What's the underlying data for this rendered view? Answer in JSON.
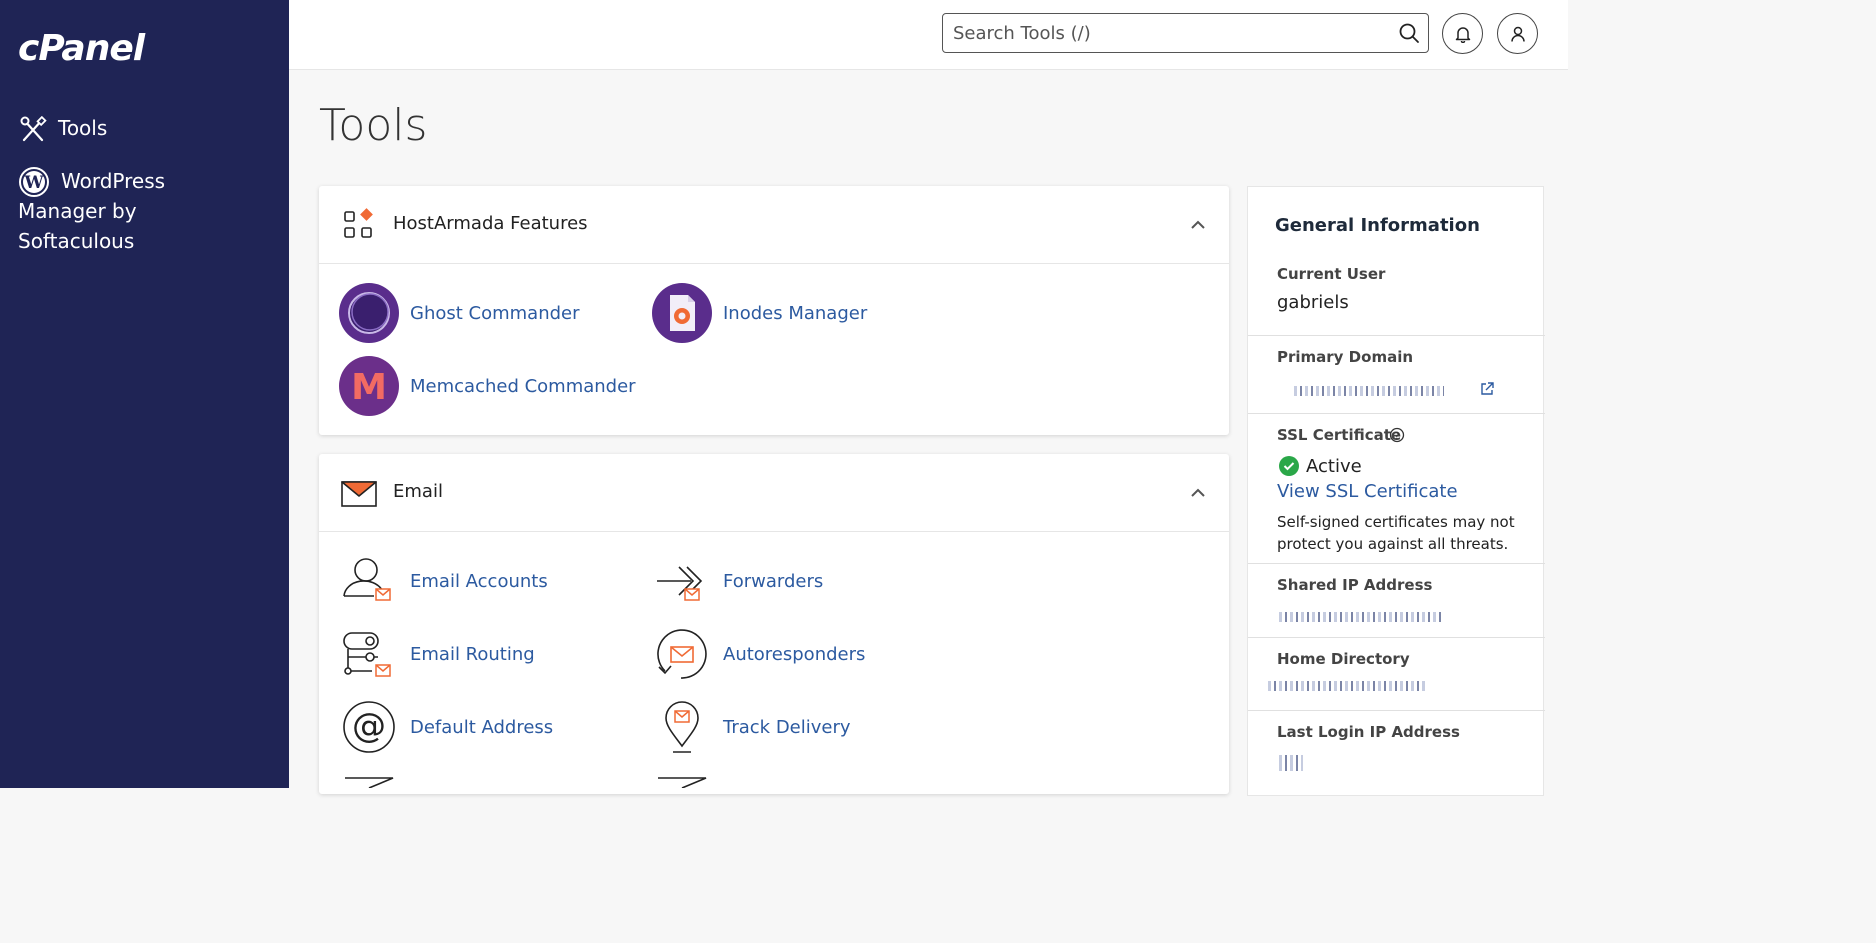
{
  "sidebar": {
    "logo": "cPanel",
    "items": [
      {
        "label": "Tools",
        "icon": "tools-icon"
      },
      {
        "label": "WordPress Manager by Softaculous",
        "icon": "wordpress-icon"
      }
    ],
    "bg_color": "#1f2455"
  },
  "header": {
    "search_placeholder": "Search Tools (/)"
  },
  "page": {
    "title": "Tools"
  },
  "sections": {
    "hostarmada": {
      "title": "HostArmada Features",
      "tools": [
        {
          "label": "Ghost Commander",
          "icon": "ghost-commander-icon"
        },
        {
          "label": "Inodes Manager",
          "icon": "inodes-manager-icon"
        },
        {
          "label": "Memcached Commander",
          "icon": "memcached-commander-icon"
        }
      ]
    },
    "email": {
      "title": "Email",
      "tools": [
        {
          "label": "Email Accounts",
          "icon": "email-accounts-icon"
        },
        {
          "label": "Forwarders",
          "icon": "forwarders-icon"
        },
        {
          "label": "Email Routing",
          "icon": "email-routing-icon"
        },
        {
          "label": "Autoresponders",
          "icon": "autoresponders-icon"
        },
        {
          "label": "Default Address",
          "icon": "default-address-icon"
        },
        {
          "label": "Track Delivery",
          "icon": "track-delivery-icon"
        }
      ]
    }
  },
  "general_info": {
    "title": "General Information",
    "current_user_label": "Current User",
    "current_user": "gabriels",
    "primary_domain_label": "Primary Domain",
    "ssl_label": "SSL Certificate",
    "ssl_status": "Active",
    "ssl_link": "View SSL Certificate",
    "ssl_note": "Self-signed certificates may not protect you against all threats.",
    "shared_ip_label": "Shared IP Address",
    "home_dir_label": "Home Directory",
    "last_login_label": "Last Login IP Address"
  },
  "colors": {
    "accent": "#2c5aa0",
    "email_orange": "#f06a35",
    "active_green": "#2aa748"
  }
}
